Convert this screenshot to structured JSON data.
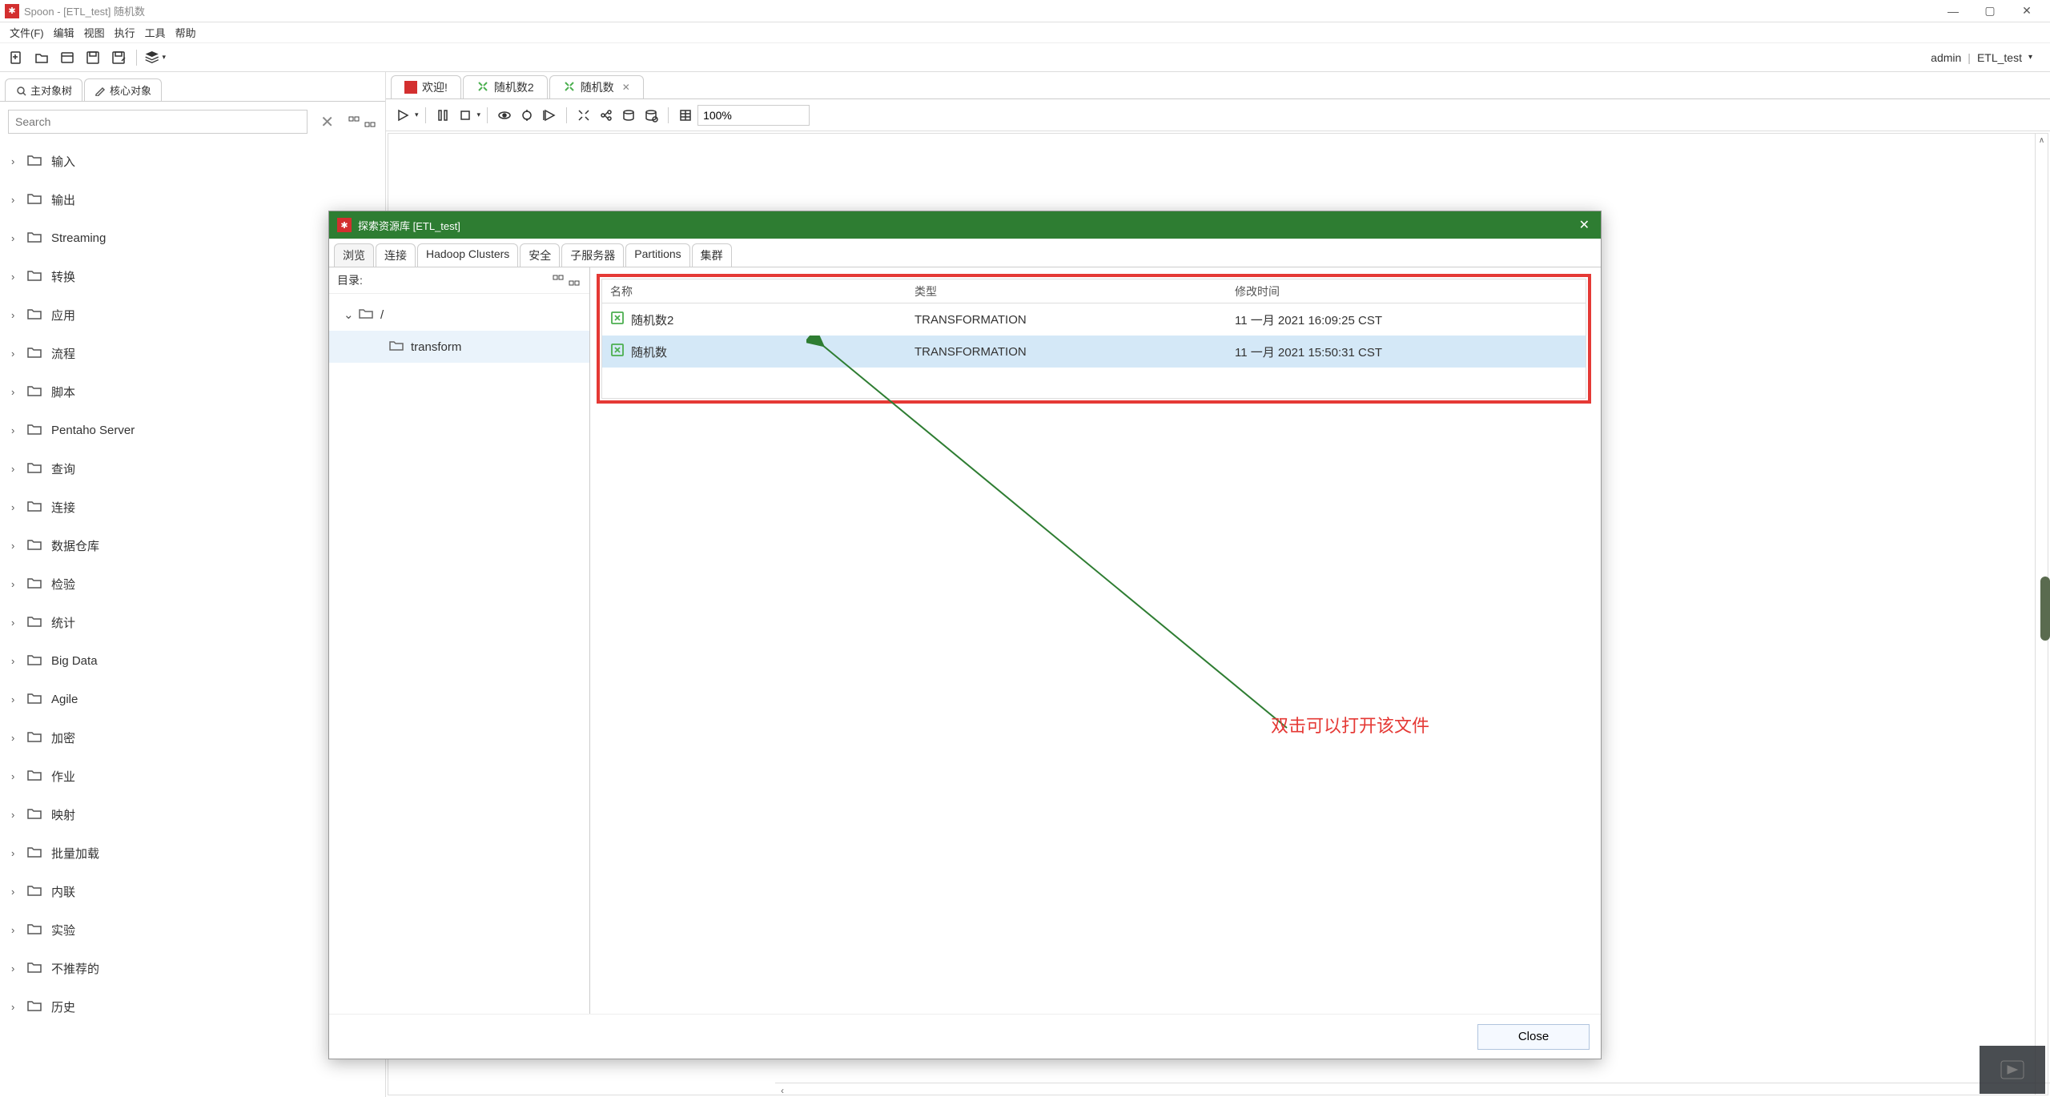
{
  "window": {
    "title": "Spoon - [ETL_test] 随机数"
  },
  "menu": [
    "文件(F)",
    "编辑",
    "视图",
    "执行",
    "工具",
    "帮助"
  ],
  "header_right": {
    "user": "admin",
    "sep": "|",
    "repo": "ETL_test"
  },
  "left_panel": {
    "tabs": {
      "main": "主对象树",
      "core": "核心对象"
    },
    "search_placeholder": "Search",
    "tree": [
      "输入",
      "输出",
      "Streaming",
      "转换",
      "应用",
      "流程",
      "脚本",
      "Pentaho Server",
      "查询",
      "连接",
      "数据仓库",
      "检验",
      "统计",
      "Big Data",
      "Agile",
      "加密",
      "作业",
      "映射",
      "批量加载",
      "内联",
      "实验",
      "不推荐的",
      "历史"
    ]
  },
  "canvas": {
    "tabs": [
      {
        "label": "欢迎!",
        "kind": "welcome"
      },
      {
        "label": "随机数2",
        "kind": "trans"
      },
      {
        "label": "随机数",
        "kind": "trans",
        "active": true
      }
    ],
    "zoom": "100%"
  },
  "dialog": {
    "title": "探索资源库 [ETL_test]",
    "tabs": [
      "浏览",
      "连接",
      "Hadoop Clusters",
      "安全",
      "子服务器",
      "Partitions",
      "集群"
    ],
    "dir_label": "目录:",
    "tree": {
      "root": "/",
      "child": "transform"
    },
    "columns": {
      "name": "名称",
      "type": "类型",
      "modified": "修改时间"
    },
    "rows": [
      {
        "name": "随机数2",
        "type": "TRANSFORMATION",
        "modified": "11 一月 2021 16:09:25 CST"
      },
      {
        "name": "随机数",
        "type": "TRANSFORMATION",
        "modified": "11 一月 2021 15:50:31 CST",
        "selected": true
      }
    ],
    "annotation": "双击可以打开该文件",
    "close": "Close"
  }
}
